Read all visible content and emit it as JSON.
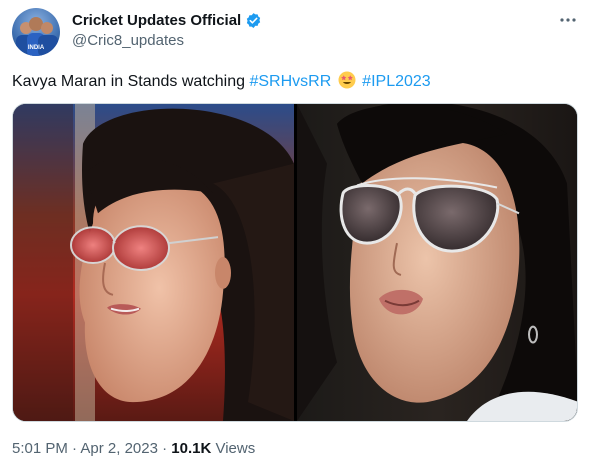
{
  "author": {
    "display_name": "Cricket Updates Official",
    "handle": "@Cric8_updates",
    "avatar_icon": "avatar-photo",
    "avatar_text": "INDIA"
  },
  "tweet": {
    "text_prefix": "Kavya Maran in Stands watching ",
    "hashtag1": "#SRHvsRR",
    "hashtag2": "#IPL2023",
    "emoji": "star-struck-emoji"
  },
  "meta": {
    "time": "5:01 PM",
    "sep1": " · ",
    "date": "Apr 2, 2023",
    "sep2": " · ",
    "views_count": "10.1K",
    "views_label": " Views"
  },
  "colors": {
    "link": "#1d9bf0",
    "muted": "#536471",
    "text": "#0f1419",
    "verified": "#1d9bf0"
  }
}
